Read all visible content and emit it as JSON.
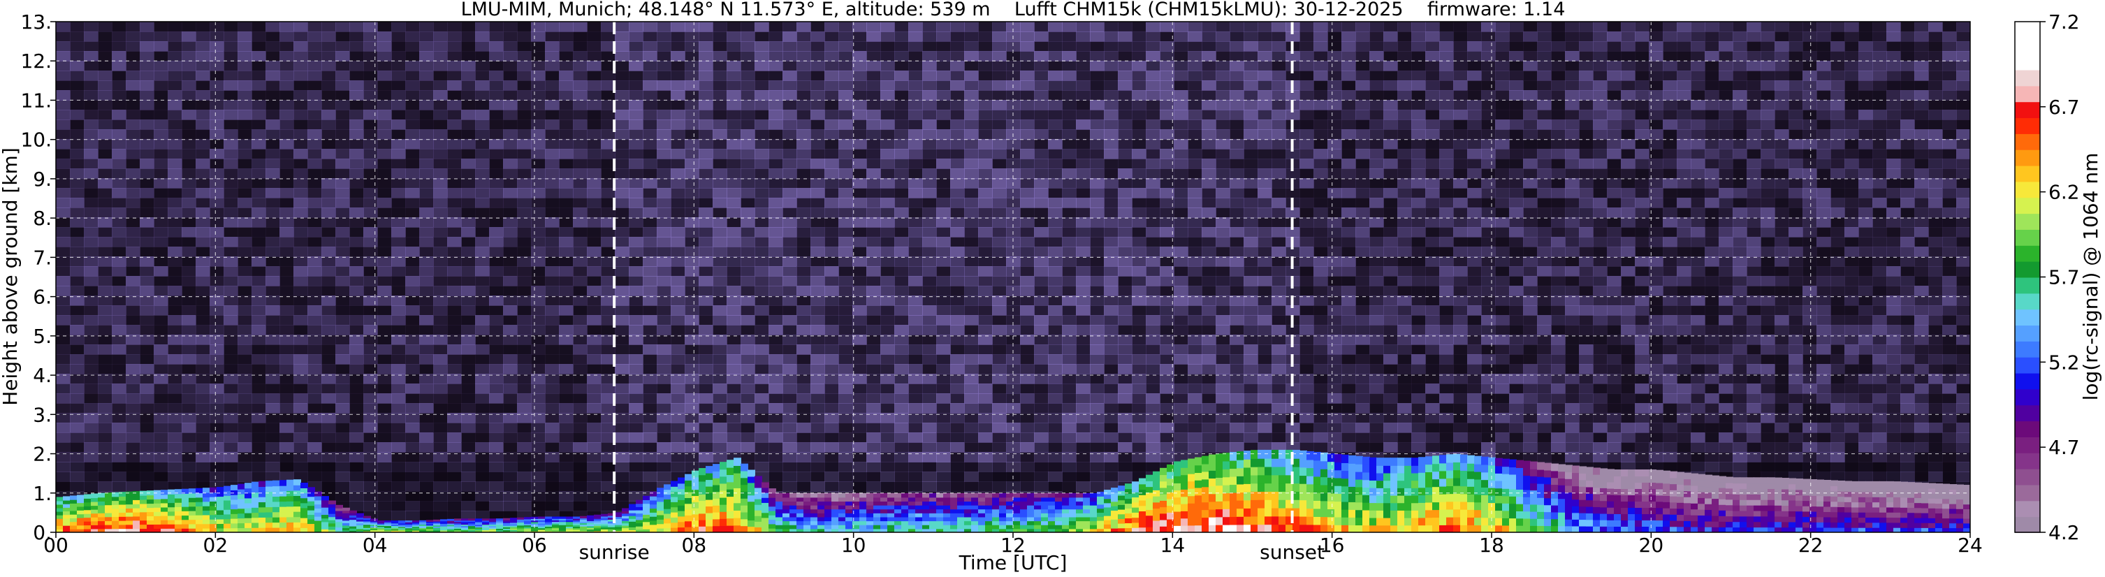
{
  "chart_data": {
    "type": "heatmap",
    "title": "LMU-MIM, Munich; 48.148° N 11.573° E, altitude: 539 m    Lufft CHM15k (CHM15kLMU): 30-12-2025    firmware: 1.14",
    "xlabel": "Time [UTC]",
    "ylabel": "Height above ground [km]",
    "xlim": [
      0,
      24
    ],
    "ylim": [
      0,
      13
    ],
    "x_ticks": [
      "00",
      "02",
      "04",
      "06",
      "08",
      "10",
      "12",
      "14",
      "16",
      "18",
      "20",
      "22",
      "24"
    ],
    "y_ticks": [
      "0.",
      "1.",
      "2.",
      "3.",
      "4.",
      "5.",
      "6.",
      "7.",
      "8.",
      "9.",
      "10.",
      "11.",
      "12.",
      "13."
    ],
    "grid": true,
    "annotations": [
      {
        "label": "sunrise",
        "x": 7.0
      },
      {
        "label": "sunset",
        "x": 15.5
      }
    ],
    "colorbar": {
      "label": "log(rc-signal) @ 1064 nm",
      "range": [
        4.2,
        7.2
      ],
      "ticks": [
        "4.2",
        "4.7",
        "5.2",
        "5.7",
        "6.2",
        "6.7",
        "7.2"
      ],
      "colors": [
        "#9f8aa8",
        "#ab8eb2",
        "#9b6a9b",
        "#8f4f90",
        "#85348a",
        "#7a1f80",
        "#6c0a7a",
        "#5000a0",
        "#3000cc",
        "#1010ee",
        "#2a4fff",
        "#3d7bff",
        "#55a0ff",
        "#6fc3ff",
        "#58d8c8",
        "#2ec47d",
        "#139a2f",
        "#2bb32b",
        "#66d24a",
        "#9fe55a",
        "#d6f24f",
        "#f7e83a",
        "#ffc61f",
        "#ff9a10",
        "#ff6a0a",
        "#ff2c05",
        "#f21010",
        "#f6b6b6",
        "#efd4d4",
        "#ffffff",
        "#ffffff",
        "#ffffff"
      ]
    },
    "signal_profile": {
      "x": [
        0,
        0.5,
        1,
        1.5,
        2,
        2.5,
        3,
        3.5,
        4,
        4.5,
        5,
        5.5,
        6,
        6.5,
        7,
        7.5,
        8,
        8.5,
        9,
        9.5,
        10,
        10.5,
        11,
        11.5,
        12,
        12.5,
        13,
        13.5,
        14,
        14.5,
        15,
        15.5,
        16,
        16.5,
        17,
        17.5,
        18,
        18.5,
        19,
        19.5,
        20,
        20.5,
        21,
        21.5,
        22,
        22.5,
        23,
        23.5,
        24
      ],
      "layer_top_km": [
        0.9,
        1.0,
        1.05,
        1.1,
        1.15,
        1.3,
        1.35,
        0.7,
        0.3,
        0.3,
        0.35,
        0.35,
        0.4,
        0.4,
        0.5,
        1.1,
        1.6,
        1.9,
        1.0,
        1.0,
        1.0,
        1.0,
        1.0,
        1.0,
        1.0,
        1.0,
        1.0,
        1.3,
        1.8,
        2.0,
        2.1,
        2.1,
        2.0,
        1.9,
        1.9,
        2.0,
        1.9,
        1.8,
        1.7,
        1.6,
        1.6,
        1.5,
        1.4,
        1.4,
        1.35,
        1.3,
        1.3,
        1.25,
        1.2
      ],
      "layer_intensity": [
        6.3,
        6.5,
        6.6,
        6.3,
        6.0,
        6.0,
        6.2,
        5.5,
        5.9,
        5.9,
        5.8,
        5.8,
        5.9,
        5.9,
        5.8,
        6.0,
        6.4,
        6.3,
        5.6,
        5.3,
        5.4,
        5.5,
        5.5,
        5.5,
        5.6,
        5.7,
        6.0,
        6.5,
        6.6,
        6.6,
        6.5,
        6.3,
        6.1,
        6.0,
        6.2,
        6.3,
        6.1,
        5.6,
        5.2,
        5.0,
        5.0,
        4.9,
        4.9,
        4.9,
        4.9,
        4.9,
        4.9,
        4.9,
        4.9
      ],
      "background_noise": 4.6
    }
  }
}
